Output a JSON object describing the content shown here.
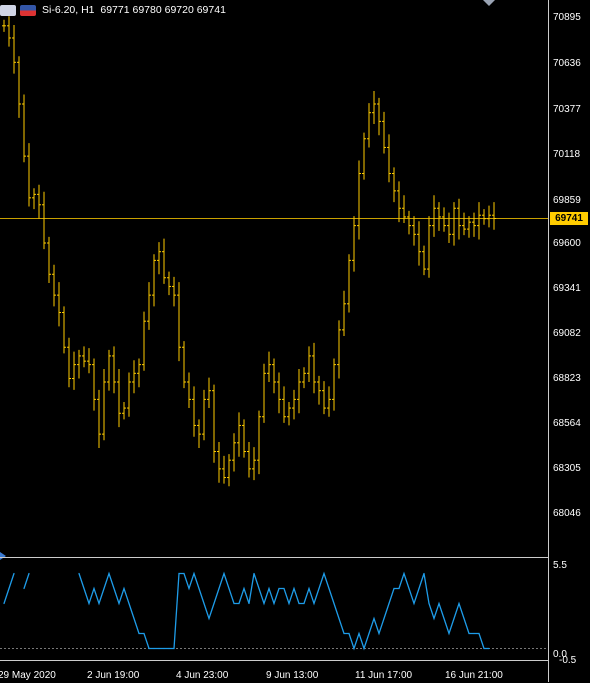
{
  "title": {
    "symbol_text": "Si-6.20, H1",
    "ohlc_text": "69771 69780 69720 69741"
  },
  "price_axis": {
    "labels": [
      "70895",
      "70636",
      "70377",
      "70118",
      "69859",
      "69600",
      "69341",
      "69082",
      "68823",
      "68564",
      "68305",
      "68046"
    ],
    "current_price": "69741"
  },
  "subwindow_axis": {
    "top_label": "5.5",
    "bottom_labels": [
      "0.0",
      "-0.5"
    ]
  },
  "time_axis": {
    "labels": [
      "29 May 2020",
      "2 Jun 19:00",
      "4 Jun 23:00",
      "9 Jun 13:00",
      "11 Jun 17:00",
      "16 Jun 21:00"
    ]
  },
  "colors": {
    "background": "#000000",
    "bars": "#ffcc00",
    "price_line": "#c8a000",
    "indicator": "#1e9ce8",
    "grid_dotted": "#777777"
  },
  "chart_data": [
    {
      "type": "line",
      "subtype": "ohlc-bars",
      "title": "",
      "xlabel": "",
      "ylabel": "",
      "ylim": [
        67900,
        71000
      ],
      "current_price": 69741,
      "x": [
        0,
        5,
        10,
        15,
        20,
        25,
        30,
        35,
        40,
        45,
        50,
        55,
        60,
        65,
        70,
        75,
        80,
        85,
        90,
        95,
        100,
        105,
        110,
        115,
        120,
        125,
        130,
        135,
        140,
        145,
        150,
        155,
        160,
        165,
        170,
        175,
        180,
        185,
        190,
        195,
        200,
        205,
        210,
        215,
        220,
        225,
        230,
        235,
        240,
        245,
        250,
        255,
        260,
        265,
        270,
        275,
        280,
        285,
        290,
        295,
        300,
        305,
        310,
        315,
        320,
        325,
        330,
        335,
        340,
        345,
        350,
        355,
        360,
        365,
        370,
        375,
        380,
        385,
        390,
        395,
        400,
        405,
        410,
        415,
        420,
        425,
        430,
        435,
        440,
        445,
        450,
        455,
        460,
        465,
        470,
        475,
        480,
        485,
        490
      ],
      "series": [
        {
          "values": [
            70850,
            70780,
            70640,
            70400,
            70100,
            69860,
            69880,
            69820,
            69600,
            69420,
            69300,
            69200,
            69000,
            68820,
            68900,
            68950,
            68920,
            68900,
            68700,
            68500,
            68800,
            68950,
            68800,
            68620,
            68650,
            68800,
            68850,
            68900,
            69150,
            69300,
            69500,
            69550,
            69400,
            69350,
            69300,
            69000,
            68800,
            68700,
            68550,
            68500,
            68700,
            68750,
            68400,
            68300,
            68250,
            68350,
            68450,
            68550,
            68400,
            68300,
            68350,
            68600,
            68850,
            68900,
            68800,
            68700,
            68600,
            68650,
            68700,
            68800,
            68850,
            68950,
            68800,
            68750,
            68650,
            68700,
            68900,
            69100,
            69250,
            69500,
            69700,
            70000,
            70200,
            70350,
            70400,
            70300,
            70150,
            70000,
            69900,
            69800,
            69750,
            69700,
            69650,
            69550,
            69450,
            69700,
            69800,
            69750,
            69700,
            69650,
            69800,
            69700,
            69680,
            69720,
            69700,
            69760,
            69740,
            69760,
            69741
          ]
        }
      ]
    },
    {
      "type": "line",
      "title": "",
      "xlabel": "",
      "ylabel": "",
      "ylim": [
        -0.5,
        5.5
      ],
      "x": [
        0,
        5,
        10,
        15,
        20,
        25,
        30,
        35,
        40,
        45,
        50,
        55,
        60,
        65,
        70,
        75,
        80,
        85,
        90,
        95,
        100,
        105,
        110,
        115,
        120,
        125,
        130,
        135,
        140,
        145,
        150,
        155,
        160,
        165,
        170,
        175,
        180,
        185,
        190,
        195,
        200,
        205,
        210,
        215,
        220,
        225,
        230,
        235,
        240,
        245,
        250,
        255,
        260,
        265,
        270,
        275,
        280,
        285,
        290,
        295,
        300,
        305,
        310,
        315,
        320,
        325,
        330,
        335,
        340,
        345,
        350,
        355,
        360,
        365,
        370,
        375,
        380,
        385,
        390,
        395,
        400,
        405,
        410,
        415,
        420,
        425,
        430,
        435,
        440,
        445,
        450,
        455,
        460,
        465,
        470,
        475,
        480,
        485
      ],
      "series": [
        {
          "values": [
            3,
            4,
            5,
            null,
            4,
            5,
            null,
            null,
            null,
            null,
            null,
            null,
            null,
            null,
            null,
            5,
            4,
            3,
            4,
            3,
            4,
            5,
            4,
            3,
            4,
            3,
            2,
            1,
            1,
            0,
            0,
            0,
            0,
            0,
            0,
            5,
            5,
            4,
            5,
            4,
            3,
            2,
            3,
            4,
            5,
            4,
            3,
            3,
            4,
            3,
            5,
            4,
            3,
            4,
            3,
            4,
            4,
            3,
            4,
            3,
            3,
            4,
            3,
            4,
            5,
            4,
            3,
            2,
            1,
            1,
            0,
            1,
            0,
            1,
            2,
            1,
            2,
            3,
            4,
            4,
            5,
            4,
            3,
            4,
            5,
            3,
            2,
            3,
            2,
            1,
            2,
            3,
            2,
            1,
            1,
            1,
            0,
            0
          ]
        }
      ]
    }
  ]
}
